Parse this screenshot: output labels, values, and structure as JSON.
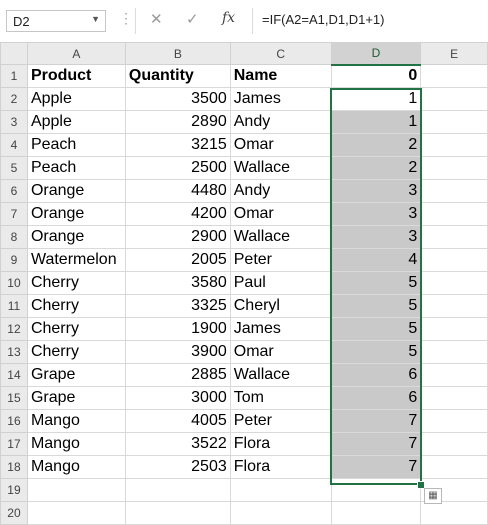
{
  "name_box": {
    "value": "D2"
  },
  "formula_bar": {
    "cancel_icon": "cancel-icon",
    "enter_icon": "enter-icon",
    "fx_label": "fx",
    "formula": "=IF(A2=A1,D1,D1+1)"
  },
  "columns": [
    "A",
    "B",
    "C",
    "D",
    "E"
  ],
  "selected_column": "D",
  "rows": [
    {
      "n": "1",
      "a": "Product",
      "b": "Quantity",
      "c": "Name",
      "d": "0"
    },
    {
      "n": "2",
      "a": "Apple",
      "b": "3500",
      "c": "James",
      "d": "1"
    },
    {
      "n": "3",
      "a": "Apple",
      "b": "2890",
      "c": "Andy",
      "d": "1"
    },
    {
      "n": "4",
      "a": "Peach",
      "b": "3215",
      "c": "Omar",
      "d": "2"
    },
    {
      "n": "5",
      "a": "Peach",
      "b": "2500",
      "c": "Wallace",
      "d": "2"
    },
    {
      "n": "6",
      "a": "Orange",
      "b": "4480",
      "c": "Andy",
      "d": "3"
    },
    {
      "n": "7",
      "a": "Orange",
      "b": "4200",
      "c": "Omar",
      "d": "3"
    },
    {
      "n": "8",
      "a": "Orange",
      "b": "2900",
      "c": "Wallace",
      "d": "3"
    },
    {
      "n": "9",
      "a": "Watermelon",
      "b": "2005",
      "c": "Peter",
      "d": "4"
    },
    {
      "n": "10",
      "a": "Cherry",
      "b": "3580",
      "c": "Paul",
      "d": "5"
    },
    {
      "n": "11",
      "a": "Cherry",
      "b": "3325",
      "c": "Cheryl",
      "d": "5"
    },
    {
      "n": "12",
      "a": "Cherry",
      "b": "1900",
      "c": "James",
      "d": "5"
    },
    {
      "n": "13",
      "a": "Cherry",
      "b": "3900",
      "c": "Omar",
      "d": "5"
    },
    {
      "n": "14",
      "a": "Grape",
      "b": "2885",
      "c": "Wallace",
      "d": "6"
    },
    {
      "n": "15",
      "a": "Grape",
      "b": "3000",
      "c": "Tom",
      "d": "6"
    },
    {
      "n": "16",
      "a": "Mango",
      "b": "4005",
      "c": "Peter",
      "d": "7"
    },
    {
      "n": "17",
      "a": "Mango",
      "b": "3522",
      "c": "Flora",
      "d": "7"
    },
    {
      "n": "18",
      "a": "Mango",
      "b": "2503",
      "c": "Flora",
      "d": "7"
    },
    {
      "n": "19",
      "a": "",
      "b": "",
      "c": "",
      "d": ""
    },
    {
      "n": "20",
      "a": "",
      "b": "",
      "c": "",
      "d": ""
    }
  ],
  "colors": {
    "selection": "#217346",
    "shaded_cell": "#c9c9c9",
    "header_bg": "#eaeaea"
  }
}
